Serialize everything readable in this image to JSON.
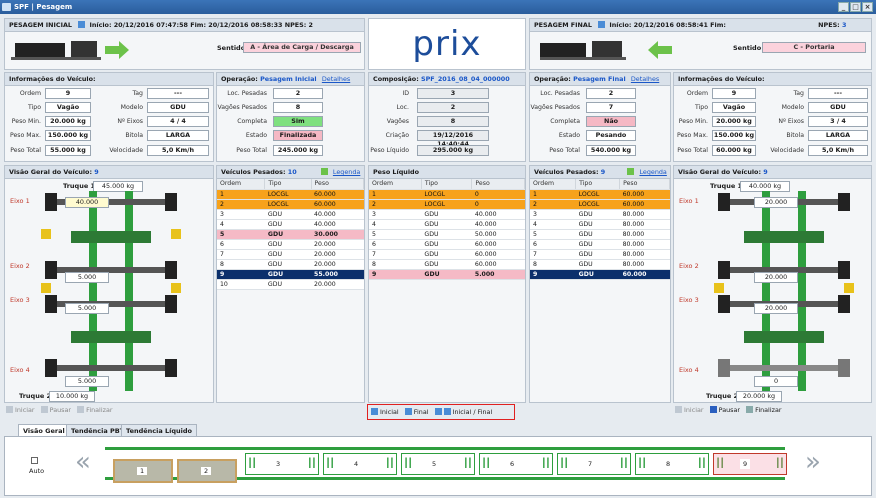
{
  "window": {
    "title": "SPF | Pesagem"
  },
  "left": {
    "header": {
      "title": "PESAGEM INICIAL",
      "inicio_label": "Início:",
      "inicio": "20/12/2016 07:47:58",
      "fim_label": "Fim:",
      "fim": "20/12/2016 08:58:33",
      "npes_label": "NPES:",
      "npes": "2"
    },
    "sentido_label": "Sentido",
    "sentido": "A - Área de Carga / Descarga",
    "info_title": "Informações do Veículo:",
    "info": {
      "ordem_l": "Ordem",
      "ordem": "9",
      "tag_l": "Tag",
      "tag": "---",
      "tipo_l": "Tipo",
      "tipo": "Vagão",
      "modelo_l": "Modelo",
      "modelo": "GDU",
      "pmin_l": "Peso Min.",
      "pmin": "20.000 kg",
      "neixos_l": "Nº Eixos",
      "neixos": "4 / 4",
      "pmax_l": "Peso Max.",
      "pmax": "150.000 kg",
      "bitola_l": "Bitola",
      "bitola": "LARGA",
      "ptotal_l": "Peso Total",
      "ptotal": "55.000 kg",
      "vel_l": "Velocidade",
      "vel": "5,0 Km/h"
    },
    "op_title": "Operação:",
    "op_name": "Pesagem Inicial",
    "op_link": "Detalhes",
    "op": {
      "loc_l": "Loc. Pesadas",
      "loc": "2",
      "vag_l": "Vagões Pesados",
      "vag": "8",
      "comp_l": "Completa",
      "comp": "Sim",
      "est_l": "Estado",
      "est": "Finalizada",
      "pt_l": "Peso Total",
      "pt": "245.000 kg"
    },
    "visao_title": "Visão Geral do Veículo:",
    "visao_n": "9",
    "truque1": "Truque 1",
    "truque1_val": "45.000 kg",
    "truque2": "Truque 2",
    "truque2_val": "10.000 kg",
    "eixo1": "Eixo 1",
    "eixo2": "Eixo 2",
    "eixo3": "Eixo 3",
    "eixo4": "Eixo 4",
    "e1": "40.000",
    "e2": "5.000",
    "e3": "5.000",
    "e4": "5.000",
    "vp_title": "Veículos Pesados:",
    "vp_n": "10",
    "legenda": "Legenda",
    "cols": [
      "Ordem",
      "Tipo",
      "Peso"
    ],
    "rows": [
      [
        "1",
        "LOCGL",
        "60.000"
      ],
      [
        "2",
        "LOCGL",
        "60.000"
      ],
      [
        "3",
        "GDU",
        "40.000"
      ],
      [
        "4",
        "GDU",
        "40.000"
      ],
      [
        "5",
        "GDU",
        "30.000"
      ],
      [
        "6",
        "GDU",
        "20.000"
      ],
      [
        "7",
        "GDU",
        "20.000"
      ],
      [
        "8",
        "GDU",
        "20.000"
      ],
      [
        "9",
        "GDU",
        "55.000"
      ],
      [
        "10",
        "GDU",
        "20.000"
      ]
    ],
    "btns": [
      "Iniciar",
      "Pausar",
      "Finalizar"
    ]
  },
  "center": {
    "logo": "prix",
    "comp_label": "Composição:",
    "comp": "SPF_2016_08_04_000000",
    "id_l": "ID",
    "id": "3",
    "loc_l": "Loc.",
    "loc": "2",
    "vag_l": "Vagões",
    "vag": "8",
    "cri_l": "Criação",
    "cri": "19/12/2016 14:40:44",
    "pl_l": "Peso Líquido",
    "pl": "295.000 kg",
    "pl_title": "Peso Líquido",
    "cols": [
      "Ordem",
      "Tipo",
      "Peso"
    ],
    "rows": [
      [
        "1",
        "LOCGL",
        "0"
      ],
      [
        "2",
        "LOCGL",
        "0"
      ],
      [
        "3",
        "GDU",
        "40.000"
      ],
      [
        "4",
        "GDU",
        "40.000"
      ],
      [
        "5",
        "GDU",
        "50.000"
      ],
      [
        "6",
        "GDU",
        "60.000"
      ],
      [
        "7",
        "GDU",
        "60.000"
      ],
      [
        "8",
        "GDU",
        "60.000"
      ],
      [
        "9",
        "GDU",
        "5.000"
      ]
    ],
    "btns": [
      "Inicial",
      "Final",
      "Inicial / Final"
    ]
  },
  "right": {
    "header": {
      "title": "PESAGEM FINAL",
      "inicio_label": "Início:",
      "inicio": "20/12/2016 08:58:41",
      "fim_label": "Fim:",
      "fim": "",
      "npes_label": "NPES:",
      "npes": "3"
    },
    "sentido_label": "Sentido",
    "sentido": "C - Portaria",
    "op_title": "Operação:",
    "op_name": "Pesagem Final",
    "op_link": "Detalhes",
    "op": {
      "loc_l": "Loc. Pesadas",
      "loc": "2",
      "vag_l": "Vagões Pesados",
      "vag": "7",
      "comp_l": "Completa",
      "comp": "Não",
      "est_l": "Estado",
      "est": "Pesando",
      "pt_l": "Peso Total",
      "pt": "540.000 kg"
    },
    "info_title": "Informações do Veículo:",
    "info": {
      "ordem_l": "Ordem",
      "ordem": "9",
      "tag_l": "Tag",
      "tag": "---",
      "tipo_l": "Tipo",
      "tipo": "Vagão",
      "modelo_l": "Modelo",
      "modelo": "GDU",
      "pmin_l": "Peso Min.",
      "pmin": "20.000 kg",
      "neixos_l": "Nº Eixos",
      "neixos": "3 / 4",
      "pmax_l": "Peso Max.",
      "pmax": "150.000 kg",
      "bitola_l": "Bitola",
      "bitola": "LARGA",
      "ptotal_l": "Peso Total",
      "ptotal": "60.000 kg",
      "vel_l": "Velocidade",
      "vel": "5,0 Km/h"
    },
    "vp_title": "Veículos Pesados:",
    "vp_n": "9",
    "legenda": "Legenda",
    "cols": [
      "Ordem",
      "Tipo",
      "Peso"
    ],
    "rows": [
      [
        "1",
        "LOCGL",
        "60.000"
      ],
      [
        "2",
        "LOCGL",
        "60.000"
      ],
      [
        "3",
        "GDU",
        "80.000"
      ],
      [
        "4",
        "GDU",
        "80.000"
      ],
      [
        "5",
        "GDU",
        "80.000"
      ],
      [
        "6",
        "GDU",
        "80.000"
      ],
      [
        "7",
        "GDU",
        "80.000"
      ],
      [
        "8",
        "GDU",
        "80.000"
      ],
      [
        "9",
        "GDU",
        "60.000"
      ]
    ],
    "visao_title": "Visão Geral do Veículo:",
    "visao_n": "9",
    "truque1": "Truque 1",
    "truque1_val": "40.000 kg",
    "truque2": "Truque 2",
    "truque2_val": "20.000 kg",
    "eixo1": "Eixo 1",
    "eixo2": "Eixo 2",
    "eixo3": "Eixo 3",
    "eixo4": "Eixo 4",
    "e1": "20.000",
    "e2": "20.000",
    "e3": "20.000",
    "e4": "0",
    "btns": [
      "Iniciar",
      "Pausar",
      "Finalizar"
    ]
  },
  "bottom": {
    "tabs": [
      "Visão Geral",
      "Tendência PBT",
      "Tendência Líquido"
    ],
    "auto": "Auto",
    "locos": [
      "1",
      "2"
    ],
    "wagons": [
      "3",
      "4",
      "5",
      "6",
      "7",
      "8",
      "9"
    ]
  },
  "colors": {
    "orange": "#f7a21b",
    "pink": "#f5bac6",
    "navy": "#0b2f6b",
    "green": "#7fe07f",
    "red": "#e02020"
  }
}
